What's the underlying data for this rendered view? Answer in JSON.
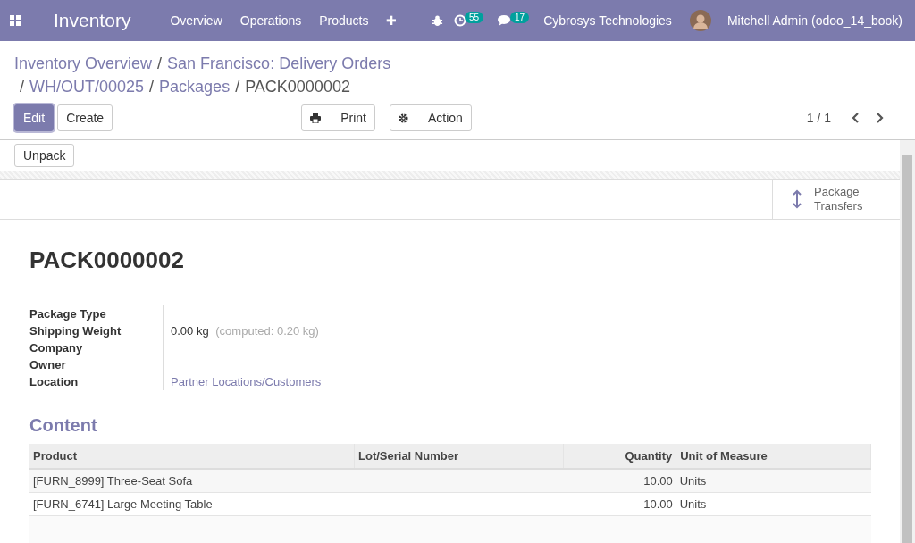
{
  "navbar": {
    "app_title": "Inventory",
    "menu": [
      "Overview",
      "Operations",
      "Products"
    ],
    "plus": "✚",
    "activity_count": "55",
    "message_count": "17",
    "company": "Cybrosys Technologies",
    "user": "Mitchell Admin (odoo_14_book)"
  },
  "breadcrumb": {
    "separator": "/",
    "items": [
      "Inventory Overview",
      "San Francisco: Delivery Orders",
      "WH/OUT/00025",
      "Packages",
      "PACK0000002"
    ]
  },
  "toolbar": {
    "edit": "Edit",
    "create": "Create",
    "print": "Print",
    "action": "Action",
    "pager": "1 / 1"
  },
  "statusbar": {
    "buttons": [
      "Unpack"
    ]
  },
  "smart_button": {
    "line1": "Package",
    "line2": "Transfers"
  },
  "record": {
    "title": "PACK0000002",
    "fields": [
      {
        "label": "Package Type"
      },
      {
        "label": "Shipping Weight",
        "value": "0.00 kg",
        "hint": "(computed: 0.20 kg)"
      },
      {
        "label": "Company"
      },
      {
        "label": "Owner"
      },
      {
        "label": "Location",
        "value": "Partner Locations/Customers",
        "kind": "link"
      }
    ]
  },
  "content": {
    "heading": "Content",
    "columns": [
      "Product",
      "Lot/Serial Number",
      "Quantity",
      "Unit of Measure"
    ],
    "rows": [
      {
        "product": "[FURN_8999] Three-Seat Sofa",
        "quantity": "10.00",
        "uom": "Units"
      },
      {
        "product": "[FURN_6741] Large Meeting Table",
        "quantity": "10.00",
        "uom": "Units"
      }
    ]
  }
}
